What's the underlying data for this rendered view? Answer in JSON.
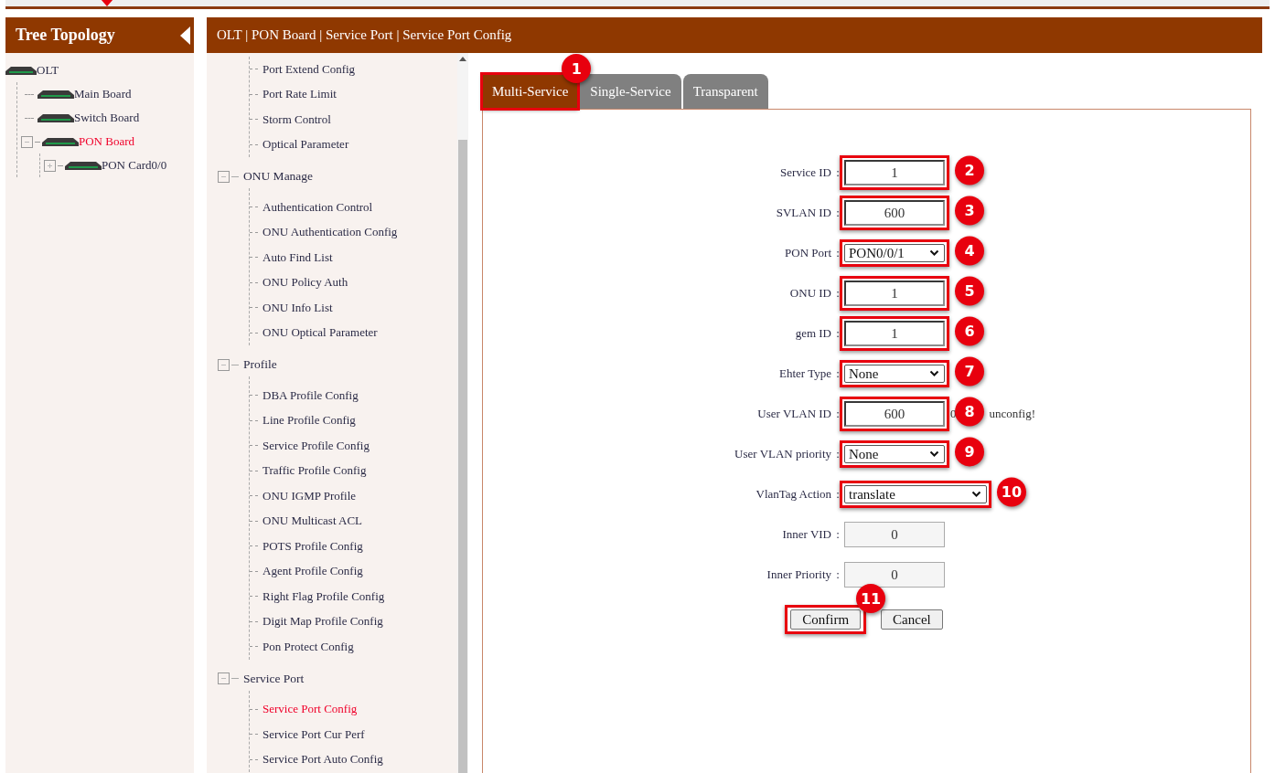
{
  "tree": {
    "title": "Tree Topology",
    "nodes": [
      {
        "label": "OLT",
        "selected": false,
        "children": [
          {
            "label": "Main Board",
            "selected": false
          },
          {
            "label": "Switch Board",
            "selected": false
          },
          {
            "label": "PON Board",
            "selected": true,
            "expanded": true,
            "children": [
              {
                "label": "PON Card0/0",
                "selected": false,
                "expanded": false
              }
            ]
          }
        ]
      }
    ]
  },
  "breadcrumb": "OLT | PON Board | Service Port | Service Port Config",
  "menu": [
    {
      "items": [
        {
          "label": "Port Extend Config",
          "selected": false
        },
        {
          "label": "Port Rate Limit",
          "selected": false
        },
        {
          "label": "Storm Control",
          "selected": false
        },
        {
          "label": "Optical Parameter",
          "selected": false
        }
      ]
    },
    {
      "label": "ONU Manage",
      "expanded": true,
      "items": [
        {
          "label": "Authentication Control",
          "selected": false
        },
        {
          "label": "ONU Authentication Config",
          "selected": false
        },
        {
          "label": "Auto Find List",
          "selected": false
        },
        {
          "label": "ONU Policy Auth",
          "selected": false
        },
        {
          "label": "ONU Info List",
          "selected": false
        },
        {
          "label": "ONU Optical Parameter",
          "selected": false
        }
      ]
    },
    {
      "label": "Profile",
      "expanded": true,
      "items": [
        {
          "label": "DBA Profile Config",
          "selected": false
        },
        {
          "label": "Line Profile Config",
          "selected": false
        },
        {
          "label": "Service Profile Config",
          "selected": false
        },
        {
          "label": "Traffic Profile Config",
          "selected": false
        },
        {
          "label": "ONU IGMP Profile",
          "selected": false
        },
        {
          "label": "ONU Multicast ACL",
          "selected": false
        },
        {
          "label": "POTS Profile Config",
          "selected": false
        },
        {
          "label": "Agent Profile Config",
          "selected": false
        },
        {
          "label": "Right Flag Profile Config",
          "selected": false
        },
        {
          "label": "Digit Map Profile Config",
          "selected": false
        },
        {
          "label": "Pon Protect Config",
          "selected": false
        }
      ]
    },
    {
      "label": "Service Port",
      "expanded": true,
      "items": [
        {
          "label": "Service Port Config",
          "selected": true
        },
        {
          "label": "Service Port Cur Perf",
          "selected": false
        },
        {
          "label": "Service Port Auto Config",
          "selected": false
        }
      ]
    }
  ],
  "tabs": [
    {
      "label": "Multi-Service",
      "selected": true,
      "highlighted": true,
      "marker": "1"
    },
    {
      "label": "Single-Service",
      "selected": false,
      "highlighted": false
    },
    {
      "label": "Transparent",
      "selected": false,
      "highlighted": false
    }
  ],
  "form": [
    {
      "label": "Service ID",
      "kind": "input",
      "value": "1",
      "highlighted": true,
      "marker": "2"
    },
    {
      "label": "SVLAN ID",
      "kind": "input",
      "value": "600",
      "highlighted": true,
      "marker": "3"
    },
    {
      "label": "PON Port",
      "kind": "select",
      "value": "PON0/0/1",
      "highlighted": true,
      "marker": "4"
    },
    {
      "label": "ONU ID",
      "kind": "input",
      "value": "1",
      "highlighted": true,
      "marker": "5"
    },
    {
      "label": "gem ID",
      "kind": "input",
      "value": "1",
      "highlighted": true,
      "marker": "6"
    },
    {
      "label": "Ehter Type",
      "kind": "select",
      "value": "None",
      "highlighted": true,
      "marker": "7"
    },
    {
      "label": "User VLAN ID",
      "kind": "input",
      "value": "600",
      "highlighted": true,
      "marker": "8",
      "hint_start": "0",
      "hint_end": "unconfig!"
    },
    {
      "label": "User VLAN priority",
      "kind": "select",
      "value": "None",
      "highlighted": true,
      "marker": "9"
    },
    {
      "label": "VlanTag Action",
      "kind": "wide_select",
      "value": "translate",
      "highlighted": true,
      "marker": "10"
    },
    {
      "label": "Inner VID",
      "kind": "readonly",
      "value": "0",
      "highlighted": false
    },
    {
      "label": "Inner Priority",
      "kind": "readonly",
      "value": "0",
      "highlighted": false
    }
  ],
  "colon": ":",
  "buttons": [
    {
      "label": "Confirm",
      "highlighted": true,
      "marker": "11"
    },
    {
      "label": "Cancel",
      "highlighted": false
    }
  ]
}
